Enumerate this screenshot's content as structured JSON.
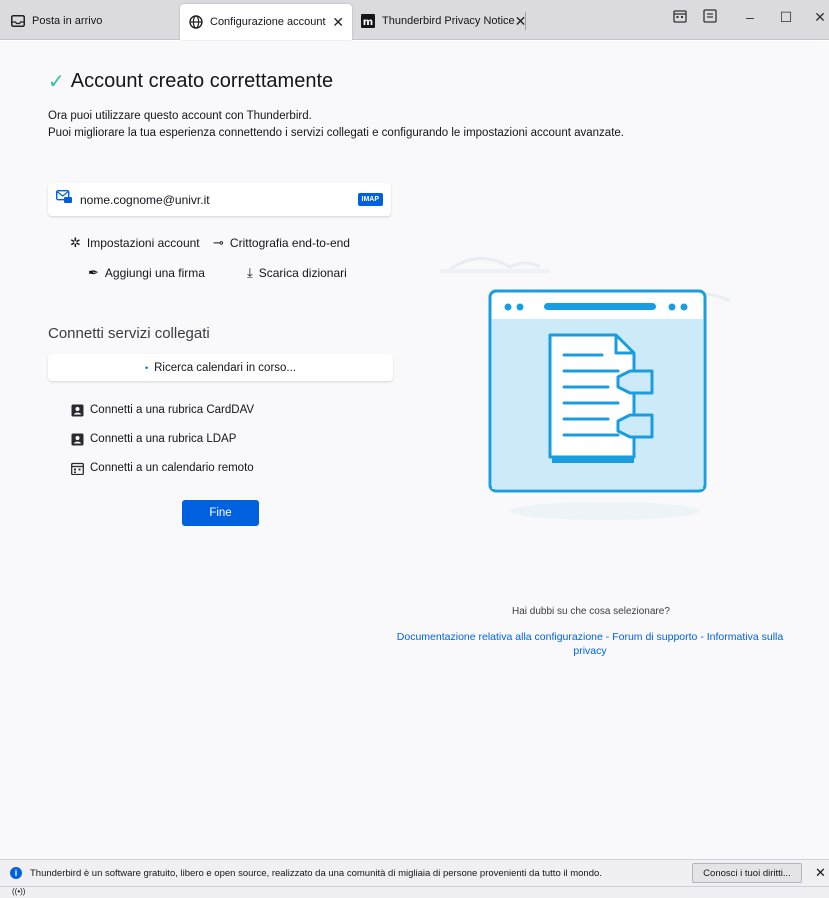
{
  "tabs": [
    {
      "label": "Posta in arrivo",
      "icon": "inbox-icon"
    },
    {
      "label": "Configurazione account",
      "icon": "globe-icon"
    },
    {
      "label": "Thunderbird Privacy Notice",
      "icon": "mozilla-icon"
    }
  ],
  "title": "Account creato correttamente",
  "intro": {
    "line1": "Ora puoi utilizzare questo account con Thunderbird.",
    "line2": "Puoi migliorare la tua esperienza connettendo i servizi collegati e configurando le impostazioni account avanzate."
  },
  "account": {
    "email": "nome.cognome@univr.it",
    "badge": "IMAP"
  },
  "actions": {
    "settings": "Impostazioni account",
    "e2e": "Crittografia end-to-end",
    "signature": "Aggiungi una firma",
    "dictionaries": "Scarica dizionari"
  },
  "connect": {
    "title": "Connetti servizi collegati",
    "calendar_search": "Ricerca calendari in corso...",
    "carddav": "Connetti a una rubrica CardDAV",
    "ldap": "Connetti a una rubrica LDAP",
    "calendar": "Connetti a un calendario remoto"
  },
  "finish_button": "Fine",
  "help": {
    "question": "Hai dubbi su che cosa selezionare?",
    "link_docs": "Documentazione relativa alla configurazione",
    "link_forum": "Forum di supporto",
    "link_privacy": "Informativa sulla privacy",
    "separator": " - "
  },
  "notification": {
    "text": "Thunderbird è un software gratuito, libero e open source, realizzato da una comunità di migliaia di persone provenienti da tutto il mondo.",
    "button": "Conosci i tuoi diritti..."
  },
  "colors": {
    "accent": "#0061e0",
    "success": "#2ac3a2",
    "illustration_blue": "#1a9de0",
    "illustration_light": "#cdeaf9"
  }
}
